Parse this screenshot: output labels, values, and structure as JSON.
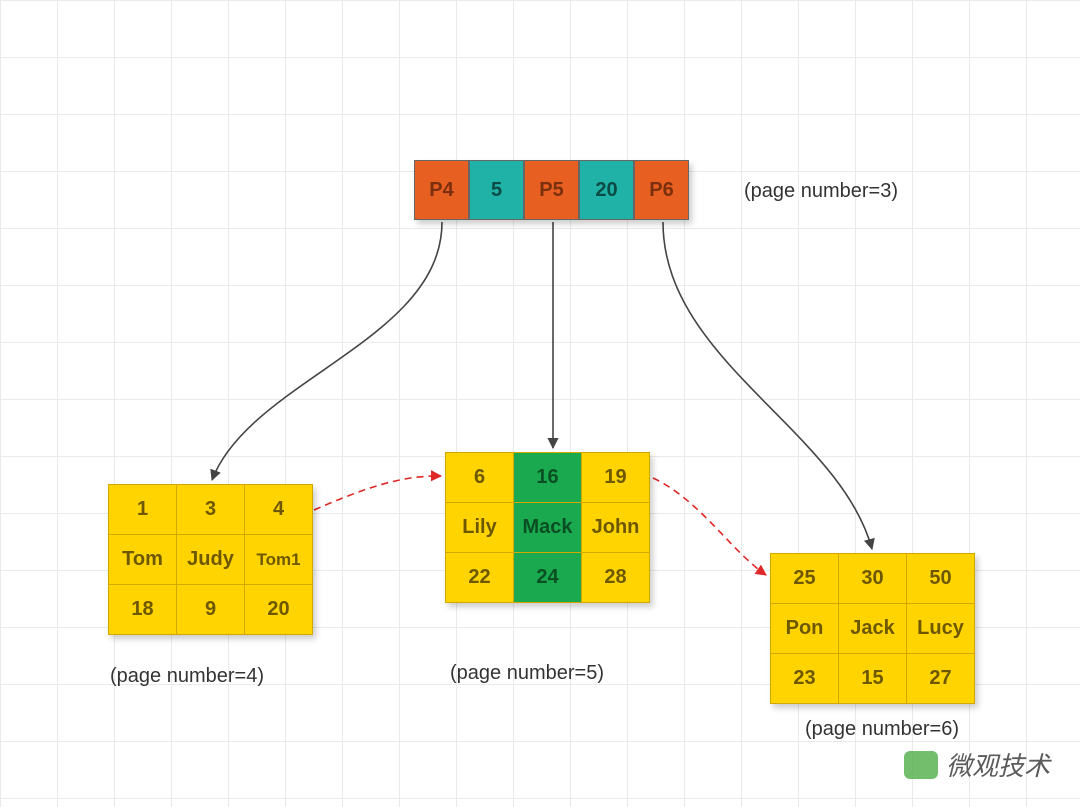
{
  "root": {
    "cells": [
      "P4",
      "5",
      "P5",
      "20",
      "P6"
    ],
    "caption": "(page number=3)"
  },
  "leaves": {
    "p4": {
      "caption": "(page number=4)",
      "rows": [
        [
          "1",
          "3",
          "4"
        ],
        [
          "Tom",
          "Judy",
          "Tom1"
        ],
        [
          "18",
          "9",
          "20"
        ]
      ],
      "highlightCol": null
    },
    "p5": {
      "caption": "(page number=5)",
      "rows": [
        [
          "6",
          "16",
          "19"
        ],
        [
          "Lily",
          "Mack",
          "John"
        ],
        [
          "22",
          "24",
          "28"
        ]
      ],
      "highlightCol": 1
    },
    "p6": {
      "caption": "(page number=6)",
      "rows": [
        [
          "25",
          "30",
          "50"
        ],
        [
          "Pon",
          "Jack",
          "Lucy"
        ],
        [
          "23",
          "15",
          "27"
        ]
      ],
      "highlightCol": null
    }
  },
  "watermark": "微观技术",
  "chart_data": {
    "type": "diagram",
    "description": "B+ tree index internal page (page 3) with three pointers P4,P5,P6 separated by keys 5 and 20, linking to three leaf pages (4,5,6). Each leaf holds 3 records: id / name / age. Leaf page 5 column with id=16 (Mack,24) is highlighted. Dashed red arrows show sibling links leaf4→leaf5→leaf6.",
    "internal_page": {
      "page_number": 3,
      "entries": [
        "P4",
        5,
        "P5",
        20,
        "P6"
      ]
    },
    "leaf_pages": [
      {
        "page_number": 4,
        "records": [
          {
            "id": 1,
            "name": "Tom",
            "age": 18
          },
          {
            "id": 3,
            "name": "Judy",
            "age": 9
          },
          {
            "id": 4,
            "name": "Tom1",
            "age": 20
          }
        ]
      },
      {
        "page_number": 5,
        "records": [
          {
            "id": 6,
            "name": "Lily",
            "age": 22
          },
          {
            "id": 16,
            "name": "Mack",
            "age": 24,
            "highlighted": true
          },
          {
            "id": 19,
            "name": "John",
            "age": 28
          }
        ]
      },
      {
        "page_number": 6,
        "records": [
          {
            "id": 25,
            "name": "Pon",
            "age": 23
          },
          {
            "id": 30,
            "name": "Jack",
            "age": 15
          },
          {
            "id": 50,
            "name": "Lucy",
            "age": 27
          }
        ]
      }
    ],
    "sibling_links": [
      [
        4,
        5
      ],
      [
        5,
        6
      ]
    ]
  }
}
